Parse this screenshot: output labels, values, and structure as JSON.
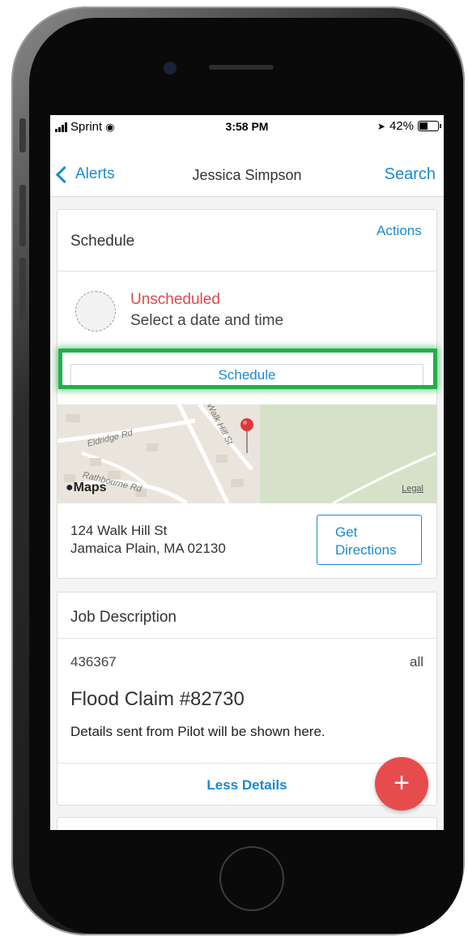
{
  "status_bar": {
    "carrier": "Sprint",
    "time": "3:58 PM",
    "battery": "42%"
  },
  "nav": {
    "back_label": "Alerts",
    "title": "Jessica Simpson",
    "search_label": "Search"
  },
  "schedule_card": {
    "title": "Schedule",
    "actions_label": "Actions",
    "status": "Unscheduled",
    "hint": "Select a date and time",
    "schedule_button": "Schedule",
    "map_brand": "Maps",
    "map_legal": "Legal",
    "roads": [
      "Eldridge Rd",
      "Walk Hill St",
      "Rathbourne Rd"
    ],
    "address_line1": "124 Walk Hill St",
    "address_line2": "Jamaica Plain, MA 02130",
    "directions_line1": "Get",
    "directions_line2": "Directions"
  },
  "job_card": {
    "title": "Job Description",
    "number": "436367",
    "scope": "all",
    "claim": "Flood Claim #82730",
    "details": "Details sent from Pilot will be shown here.",
    "less_details": "Less Details"
  },
  "fab_label": "+",
  "colors": {
    "accent": "#1a8ad1",
    "alert": "#e0474c",
    "highlight": "#22b04a",
    "fab": "#e74c4c"
  }
}
